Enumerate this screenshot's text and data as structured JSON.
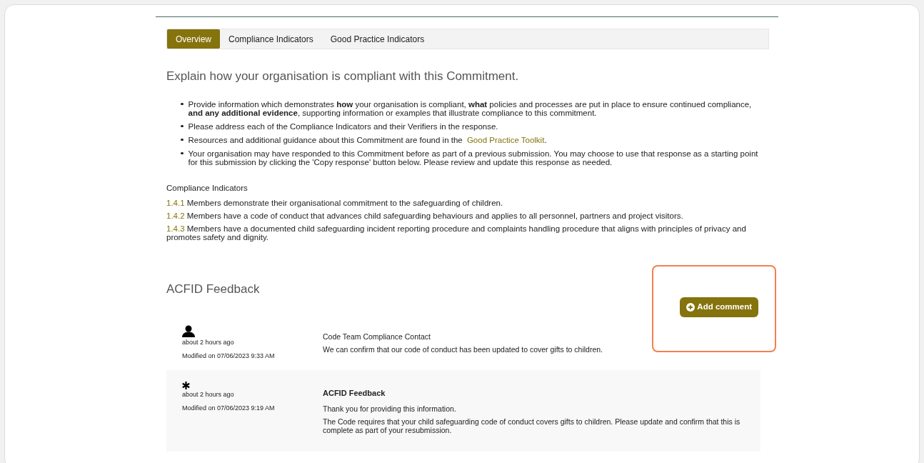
{
  "tabs": [
    {
      "label": "Overview",
      "selected": true
    },
    {
      "label": "Compliance Indicators",
      "selected": false
    },
    {
      "label": "Good Practice Indicators",
      "selected": false
    }
  ],
  "heading": "Explain how your organisation is compliant with this Commitment.",
  "bullets": [
    {
      "text": "Provide information which demonstrates **how** your organisation is compliant, **what** policies and processes are put in place to ensure continued compliance, **and any additional evidence**, supporting information or examples that illustrate compliance to this commitment."
    },
    {
      "text": "Please address each of the Compliance Indicators and their Verifiers in the response."
    },
    {
      "text": "Resources and additional guidance about this Commitment are found in the",
      "link": "Good Practice Toolkit",
      "after": "."
    },
    {
      "text": "Your organisation may have responded to this Commitment before as part of a previous submission. You may choose to use that response as a starting point for this submission by clicking the 'Copy response' button below. Please review and update this response as needed."
    }
  ],
  "indicators": {
    "title": "Compliance Indicators",
    "items": [
      {
        "code": "1.4.1",
        "text": "Members demonstrate their organisational commitment to the safeguarding of children."
      },
      {
        "code": "1.4.2",
        "text": "Members have a code of conduct that advances child safeguarding behaviours and applies to all personnel, partners and project visitors."
      },
      {
        "code": "1.4.3",
        "text": "Members have a documented child safeguarding incident reporting procedure and complaints handling procedure that aligns with principles of privacy and promotes safety and dignity."
      }
    ]
  },
  "feedback": {
    "title": "ACFID Feedback",
    "add_button": "Add comment",
    "comments": [
      {
        "kind": "member",
        "time": "about 2 hours ago",
        "modified": "Modified on 07/06/2023 9:33 AM",
        "author": "Code Team Compliance Contact",
        "paragraphs": [
          "We can confirm that our code of conduct has been updated to cover gifts to children."
        ]
      },
      {
        "kind": "acfid",
        "time": "about 2 hours ago",
        "modified": "Modified on 07/06/2023 9:19 AM",
        "author": "ACFID Feedback",
        "paragraphs": [
          "Thank you for providing this information.",
          "The Code requires that your child safeguarding code of conduct covers gifts to children. Please update and confirm that this is complete as part of your resubmission."
        ]
      }
    ]
  }
}
